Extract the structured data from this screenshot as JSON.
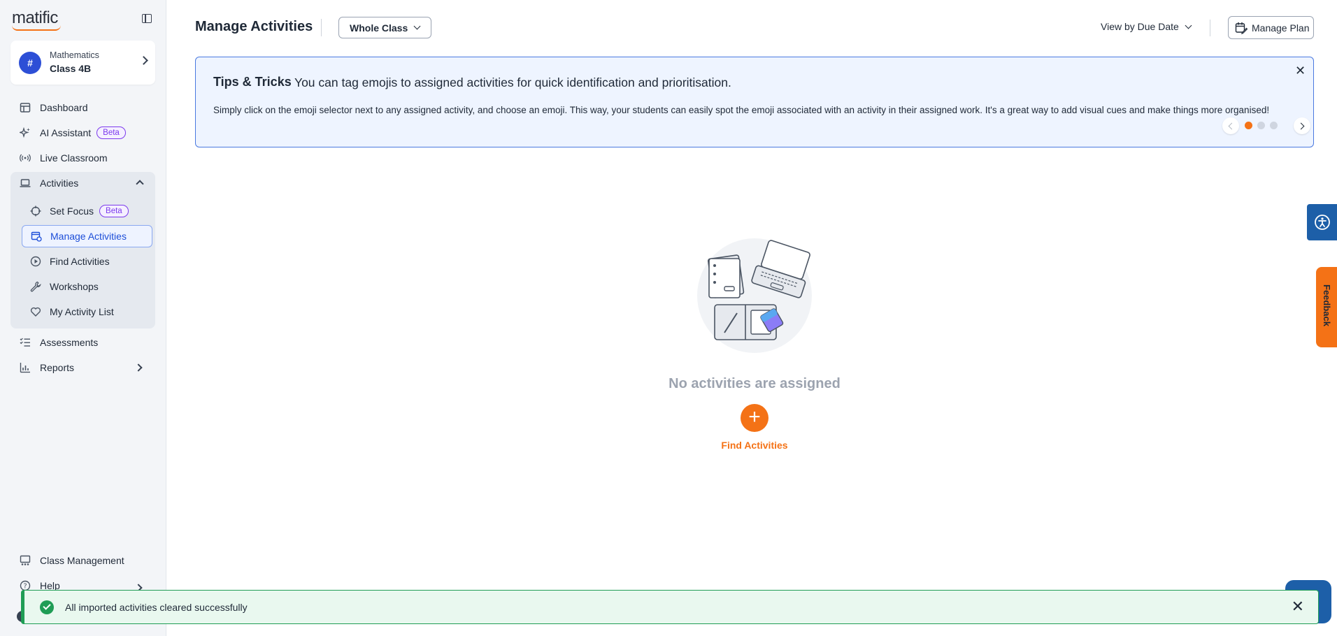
{
  "app": {
    "logo_text": "matific"
  },
  "sidebar": {
    "class_card": {
      "subject": "Mathematics",
      "class_name": "Class 4B"
    },
    "items": [
      {
        "label": "Dashboard"
      },
      {
        "label": "AI Assistant",
        "badge": "Beta"
      },
      {
        "label": "Live Classroom"
      },
      {
        "label": "Activities"
      },
      {
        "label": "Assessments"
      },
      {
        "label": "Reports"
      },
      {
        "label": "Class Management"
      },
      {
        "label": "Help"
      }
    ],
    "activities_sub": [
      {
        "label": "Set Focus",
        "badge": "Beta"
      },
      {
        "label": "Manage Activities"
      },
      {
        "label": "Find Activities"
      },
      {
        "label": "Workshops"
      },
      {
        "label": "My Activity List"
      }
    ]
  },
  "header": {
    "title": "Manage Activities",
    "class_filter": "Whole Class",
    "view_by": "View by Due Date",
    "manage_plan": "Manage Plan"
  },
  "tips": {
    "title": "Tips & Tricks",
    "headline": "You can tag emojis to assigned activities for quick identification and prioritisation.",
    "body": "Simply click on the emoji selector next to any assigned activity, and choose an emoji. This way, your students can easily spot the emoji associated with an activity in their assigned work. It's a great way to add visual cues and make things more organised!",
    "dots": 3,
    "active_dot": 1
  },
  "empty_state": {
    "message": "No activities are assigned",
    "action_label": "Find Activities"
  },
  "widgets": {
    "feedback_label": "Feedback"
  },
  "toast": {
    "message": "All imported activities cleared successfully"
  },
  "colors": {
    "accent": "#f47216",
    "primary": "#2d4fd6",
    "success": "#1f9d55"
  }
}
